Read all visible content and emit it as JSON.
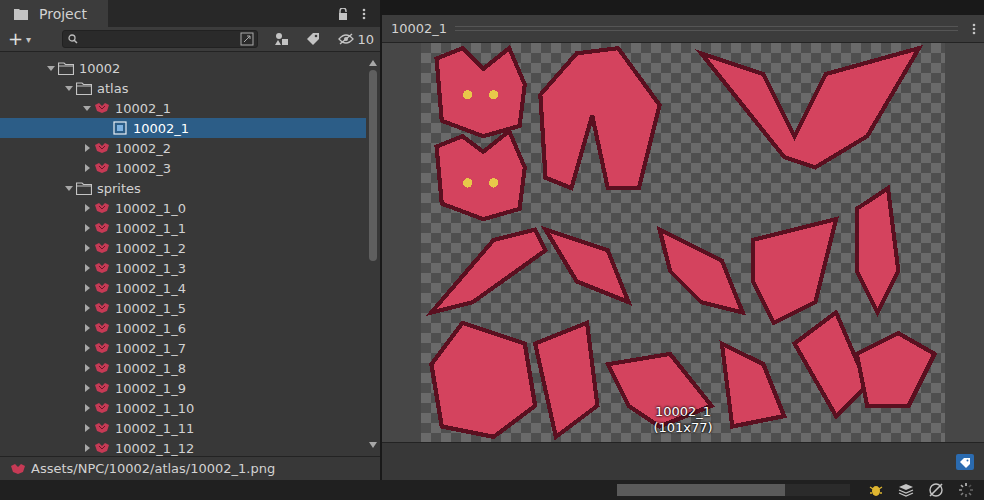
{
  "project_panel": {
    "tab": {
      "label": "Project"
    },
    "add_button": {
      "label": "+",
      "arrow": "▾"
    },
    "search": {
      "placeholder": ""
    },
    "hidden_count": "10",
    "tree": [
      {
        "label": "10002",
        "depth": 2,
        "kind": "folder",
        "expandable": true,
        "expanded": true,
        "selected": false
      },
      {
        "label": "atlas",
        "depth": 3,
        "kind": "folder",
        "expandable": true,
        "expanded": true,
        "selected": false
      },
      {
        "label": "10002_1",
        "depth": 4,
        "kind": "texture",
        "expandable": true,
        "expanded": true,
        "selected": false
      },
      {
        "label": "10002_1",
        "depth": 5,
        "kind": "sprite",
        "expandable": false,
        "expanded": false,
        "selected": true
      },
      {
        "label": "10002_2",
        "depth": 4,
        "kind": "texture",
        "expandable": true,
        "expanded": false,
        "selected": false
      },
      {
        "label": "10002_3",
        "depth": 4,
        "kind": "texture",
        "expandable": true,
        "expanded": false,
        "selected": false
      },
      {
        "label": "sprites",
        "depth": 3,
        "kind": "folder",
        "expandable": true,
        "expanded": true,
        "selected": false
      },
      {
        "label": "10002_1_0",
        "depth": 4,
        "kind": "texture",
        "expandable": true,
        "expanded": false,
        "selected": false
      },
      {
        "label": "10002_1_1",
        "depth": 4,
        "kind": "texture",
        "expandable": true,
        "expanded": false,
        "selected": false
      },
      {
        "label": "10002_1_2",
        "depth": 4,
        "kind": "texture",
        "expandable": true,
        "expanded": false,
        "selected": false
      },
      {
        "label": "10002_1_3",
        "depth": 4,
        "kind": "texture",
        "expandable": true,
        "expanded": false,
        "selected": false
      },
      {
        "label": "10002_1_4",
        "depth": 4,
        "kind": "texture",
        "expandable": true,
        "expanded": false,
        "selected": false
      },
      {
        "label": "10002_1_5",
        "depth": 4,
        "kind": "texture",
        "expandable": true,
        "expanded": false,
        "selected": false
      },
      {
        "label": "10002_1_6",
        "depth": 4,
        "kind": "texture",
        "expandable": true,
        "expanded": false,
        "selected": false
      },
      {
        "label": "10002_1_7",
        "depth": 4,
        "kind": "texture",
        "expandable": true,
        "expanded": false,
        "selected": false
      },
      {
        "label": "10002_1_8",
        "depth": 4,
        "kind": "texture",
        "expandable": true,
        "expanded": false,
        "selected": false
      },
      {
        "label": "10002_1_9",
        "depth": 4,
        "kind": "texture",
        "expandable": true,
        "expanded": false,
        "selected": false
      },
      {
        "label": "10002_1_10",
        "depth": 4,
        "kind": "texture",
        "expandable": true,
        "expanded": false,
        "selected": false
      },
      {
        "label": "10002_1_11",
        "depth": 4,
        "kind": "texture",
        "expandable": true,
        "expanded": false,
        "selected": false
      },
      {
        "label": "10002_1_12",
        "depth": 4,
        "kind": "texture",
        "expandable": true,
        "expanded": false,
        "selected": false
      }
    ],
    "scrollbar": {
      "position": 0,
      "visible": 0.52
    },
    "path": "Assets/NPC/10002/atlas/10002_1.png"
  },
  "preview": {
    "title": "10002_1",
    "image": {
      "name": "10002_1",
      "size": "(101x77)"
    }
  },
  "status_bar": {
    "progress": {
      "level": 0.72
    }
  }
}
